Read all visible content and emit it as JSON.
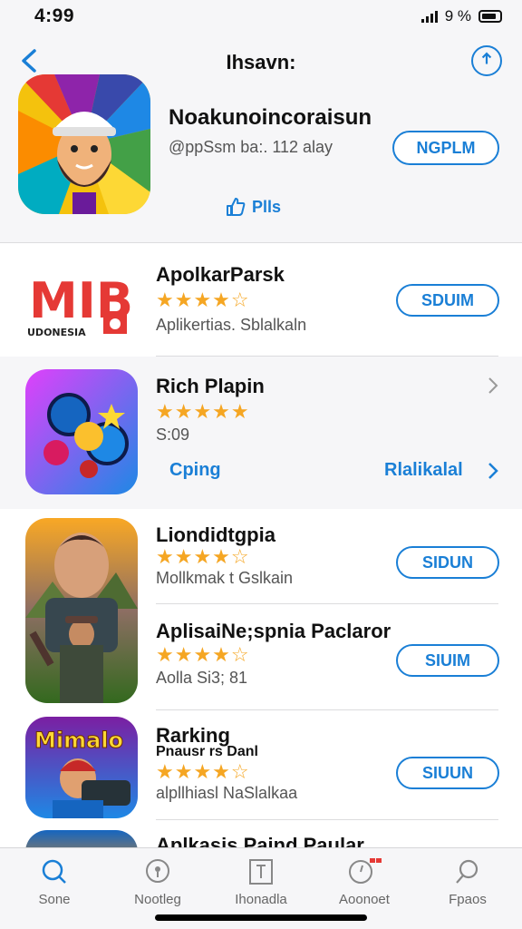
{
  "status": {
    "time": "4:99",
    "battery": "9 %"
  },
  "header": {
    "title": "Ihsavn:",
    "app_name": "Noakunoincoraisun",
    "app_subtitle": "@ppSsm ba:. 112 alay",
    "get_label": "NGPLM",
    "plus_label": "Plls"
  },
  "apps": [
    {
      "title": "ApolkarParsk",
      "stars": "★★★★☆",
      "subtitle": "Aplikertias. Sblalkaln",
      "get_label": "SDUIM",
      "icon_text": "MIB",
      "icon_caption": "UDONESIA"
    },
    {
      "title": "Rich Plapin",
      "stars": "★★★★★",
      "subtitle": "S:09",
      "link_left": "Cping",
      "link_right": "Rlalikalal"
    },
    {
      "title": "Liondidtgpia",
      "stars": "★★★★☆",
      "subtitle": "Mollkmak t Gslkain",
      "get_label": "SIDUN"
    },
    {
      "title": "AplisaiNe;spnia Paclaror",
      "stars": "★★★★☆",
      "subtitle": "Aolla Si3; 81",
      "get_label": "SIUIM"
    },
    {
      "title": "Rarking",
      "title2": "Pnausr rs Danl",
      "stars": "★★★★☆",
      "subtitle": "alpllhiasl NaSlalkaa",
      "get_label": "SIUUN",
      "icon_text": "Mimalo"
    },
    {
      "title": "Aplkasis Paind Paular"
    }
  ],
  "tabs": [
    {
      "label": "Sone",
      "icon": "search-icon"
    },
    {
      "label": "Nootleg",
      "icon": "pin-icon"
    },
    {
      "label": "Ihonadla",
      "icon": "book-icon"
    },
    {
      "label": "Aoonoet",
      "icon": "clock-icon"
    },
    {
      "label": "Fpaos",
      "icon": "magnifier-icon"
    }
  ],
  "colors": {
    "accent": "#1a7fd6",
    "star": "#f5a623",
    "badge": "#e53935"
  }
}
